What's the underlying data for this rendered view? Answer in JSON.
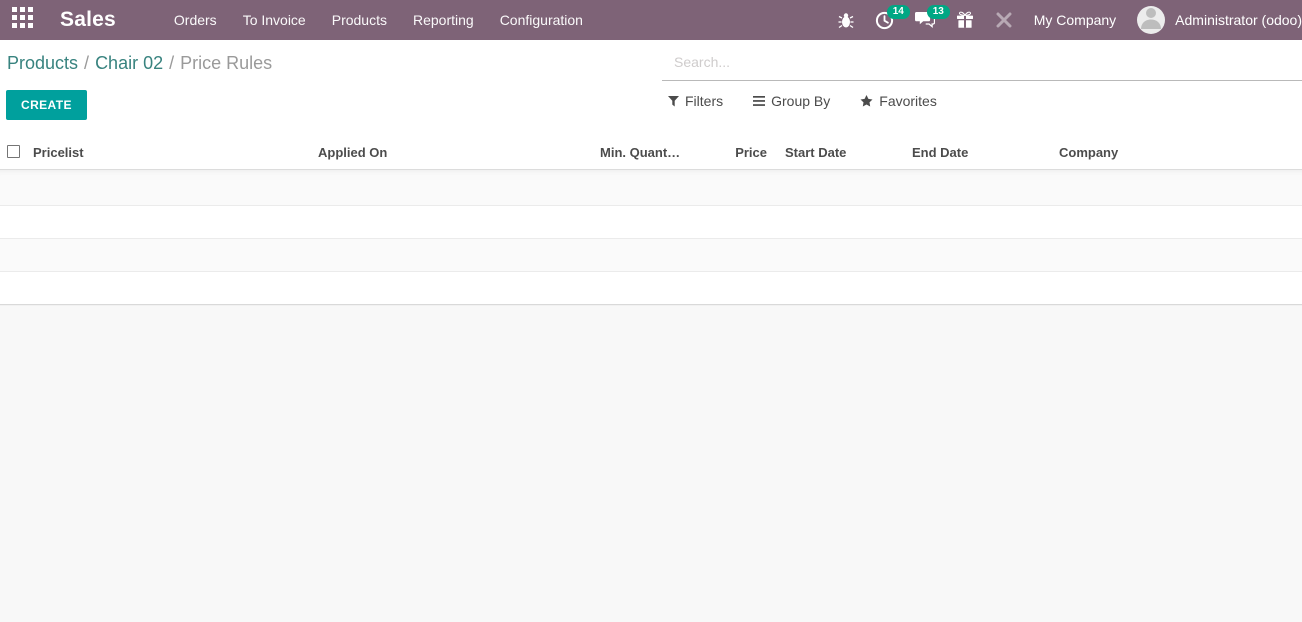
{
  "topbar": {
    "app_name": "Sales",
    "menu": [
      "Orders",
      "To Invoice",
      "Products",
      "Reporting",
      "Configuration"
    ],
    "activity_count": "14",
    "message_count": "13",
    "company": "My Company",
    "user": "Administrator (odoo)"
  },
  "colors": {
    "topbar_bg": "#7e6377",
    "accent_teal": "#00a09d",
    "badge_green": "#00a784",
    "breadcrumb_link": "#38837f"
  },
  "breadcrumb": {
    "item1": "Products",
    "item2": "Chair 02",
    "current": "Price Rules",
    "separator": "/"
  },
  "search": {
    "placeholder": "Search..."
  },
  "controls": {
    "create_label": "CREATE",
    "filters_label": "Filters",
    "group_by_label": "Group By",
    "favorites_label": "Favorites"
  },
  "table": {
    "columns": {
      "pricelist": "Pricelist",
      "applied_on": "Applied On",
      "min_quantity": "Min. Quant…",
      "price": "Price",
      "start_date": "Start Date",
      "end_date": "End Date",
      "company": "Company"
    },
    "empty_row_count": "4"
  }
}
